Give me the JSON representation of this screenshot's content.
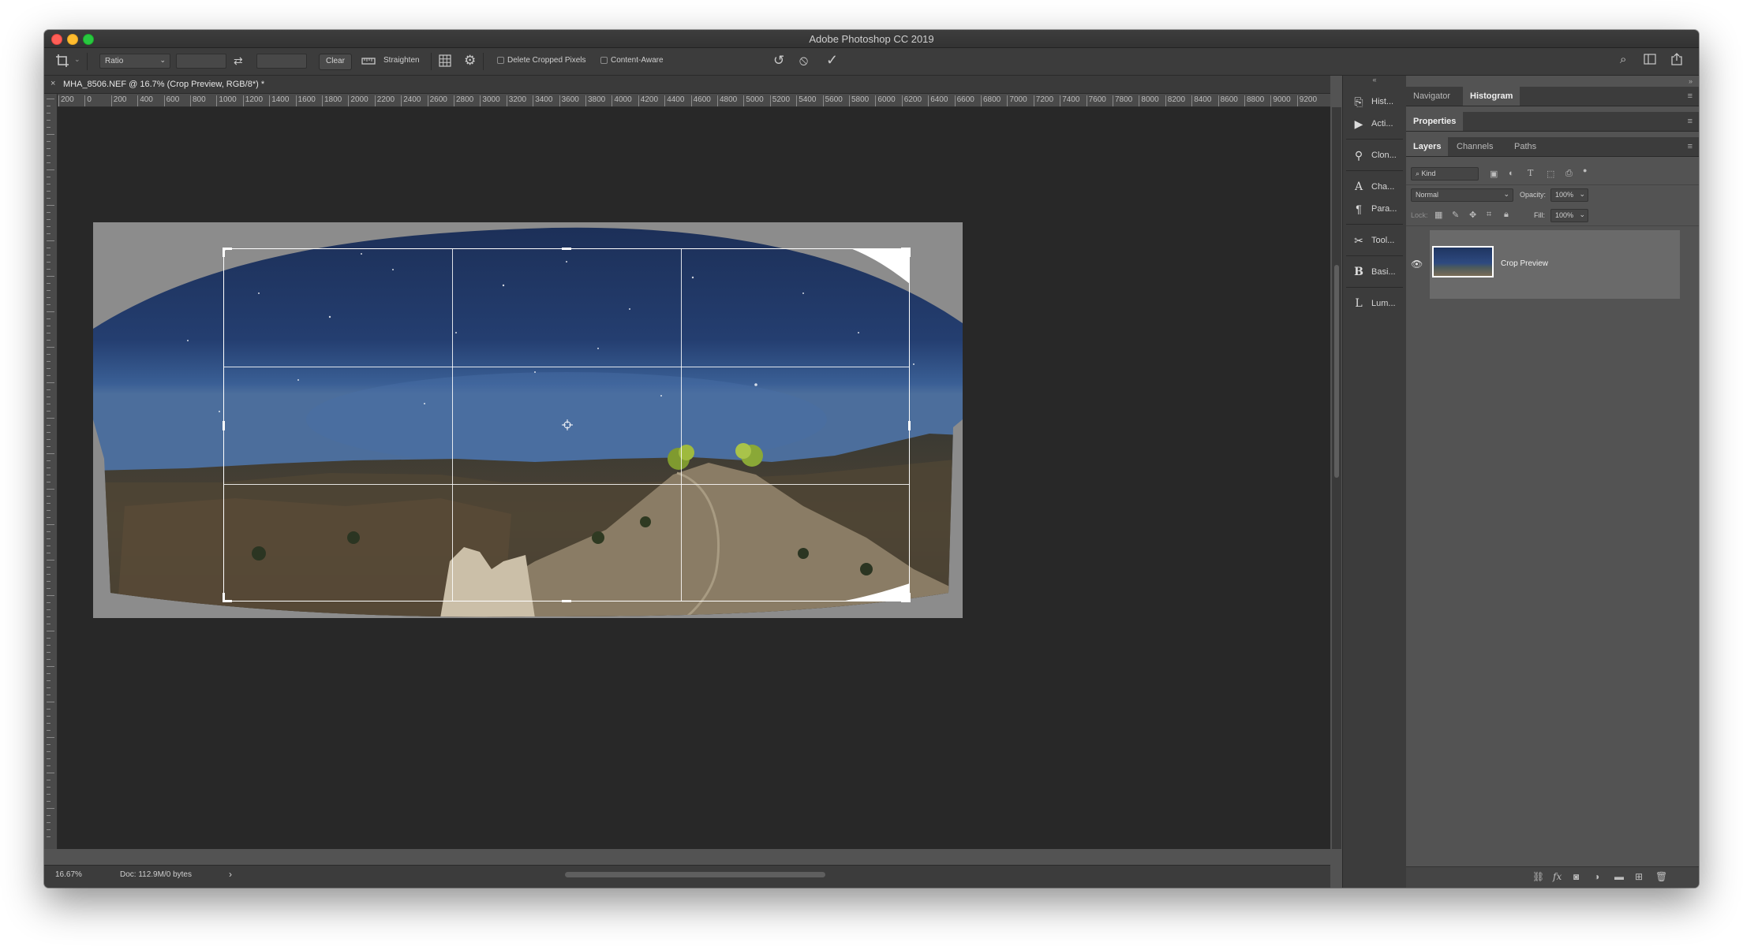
{
  "window": {
    "title": "Adobe Photoshop CC 2019"
  },
  "options_bar": {
    "ratio_select": "Ratio",
    "width_value": "",
    "height_value": "",
    "clear_label": "Clear",
    "straighten_label": "Straighten",
    "delete_cropped_label": "Delete Cropped Pixels",
    "delete_cropped_checked": false,
    "content_aware_label": "Content-Aware",
    "content_aware_checked": false
  },
  "document": {
    "tab_title": "MHA_8506.NEF @ 16.7% (Crop Preview, RGB/8*) *",
    "ruler_h_ticks": [
      "200",
      "0",
      "200",
      "400",
      "600",
      "800",
      "1000",
      "1200",
      "1400",
      "1600",
      "1800",
      "2000",
      "2200",
      "2400",
      "2600",
      "2800",
      "3000",
      "3200",
      "3400",
      "3600",
      "3800",
      "4000",
      "4200",
      "4400",
      "4600",
      "4800",
      "5000",
      "5200",
      "5400",
      "5600",
      "5800",
      "6000",
      "6200",
      "6400",
      "6600",
      "6800",
      "7000",
      "7200",
      "7400",
      "7600",
      "7800",
      "8000",
      "8200",
      "8400",
      "8600",
      "8800",
      "9000",
      "9200"
    ]
  },
  "status_bar": {
    "zoom": "16.67%",
    "doc_info": "Doc: 112.9M/0 bytes",
    "arrow": "›"
  },
  "dock": {
    "items": [
      {
        "icon": "history-icon",
        "label": "Hist..."
      },
      {
        "icon": "actions-icon",
        "label": "Acti..."
      },
      {
        "icon": "clone-source-icon",
        "label": "Clon..."
      },
      {
        "icon": "character-icon",
        "label": "Cha..."
      },
      {
        "icon": "paragraph-icon",
        "label": "Para..."
      },
      {
        "icon": "tool-presets-icon",
        "label": "Tool..."
      },
      {
        "icon": "basic-icon",
        "label": "Basi..."
      },
      {
        "icon": "luminosity-icon",
        "label": "Lum..."
      }
    ]
  },
  "panels": {
    "top_tabs": [
      "Navigator",
      "Histogram"
    ],
    "properties_tab": "Properties",
    "layer_tabs": [
      "Layers",
      "Channels",
      "Paths"
    ],
    "kind_placeholder": "Kind",
    "blend_mode": "Normal",
    "opacity_label": "Opacity:",
    "opacity_value": "100%",
    "lock_label": "Lock:",
    "fill_label": "Fill:",
    "fill_value": "100%",
    "layer_name": "Crop Preview"
  },
  "colors": {
    "app_bg": "#535353",
    "canvas_bg": "#282828",
    "sky_top": "#1c2f57",
    "sky_horizon": "#3a5f95"
  }
}
